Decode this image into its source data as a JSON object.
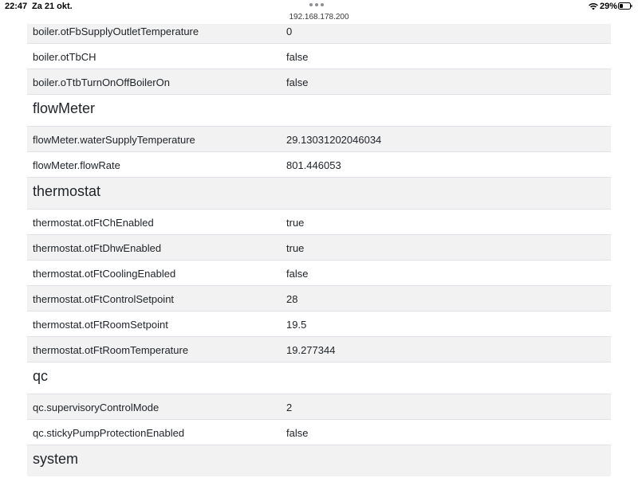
{
  "statusbar": {
    "time": "22:47",
    "date": "Za 21 okt.",
    "url": "192.168.178.200",
    "battery": "29%"
  },
  "boiler": {
    "rows": [
      {
        "key": "boiler.otFbSupplyOutletTemperature",
        "value": "0"
      },
      {
        "key": "boiler.otTbCH",
        "value": "false"
      },
      {
        "key": "boiler.oTtbTurnOnOffBoilerOn",
        "value": "false"
      }
    ]
  },
  "flowMeter": {
    "title": "flowMeter",
    "rows": [
      {
        "key": "flowMeter.waterSupplyTemperature",
        "value": "29.13031202046034"
      },
      {
        "key": "flowMeter.flowRate",
        "value": "801.446053"
      }
    ]
  },
  "thermostat": {
    "title": "thermostat",
    "rows": [
      {
        "key": "thermostat.otFtChEnabled",
        "value": "true"
      },
      {
        "key": "thermostat.otFtDhwEnabled",
        "value": "true"
      },
      {
        "key": "thermostat.otFtCoolingEnabled",
        "value": "false"
      },
      {
        "key": "thermostat.otFtControlSetpoint",
        "value": "28"
      },
      {
        "key": "thermostat.otFtRoomSetpoint",
        "value": "19.5"
      },
      {
        "key": "thermostat.otFtRoomTemperature",
        "value": "19.277344"
      }
    ]
  },
  "qc": {
    "title": "qc",
    "rows": [
      {
        "key": "qc.supervisoryControlMode",
        "value": "2"
      },
      {
        "key": "qc.stickyPumpProtectionEnabled",
        "value": "false"
      }
    ]
  },
  "system": {
    "title": "system"
  }
}
